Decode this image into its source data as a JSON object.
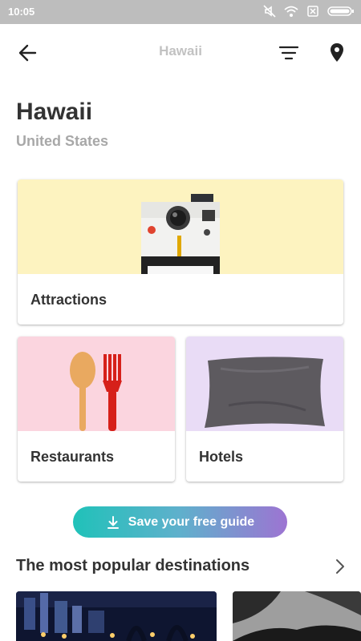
{
  "status": {
    "time": "10:05"
  },
  "appbar": {
    "title": "Hawaii"
  },
  "header": {
    "title": "Hawaii",
    "subtitle": "United States"
  },
  "categories": [
    {
      "label": "Attractions",
      "color": "#fdf3c0"
    },
    {
      "label": "Restaurants",
      "color": "#fbd5df"
    },
    {
      "label": "Hotels",
      "color": "#e9dcf6"
    }
  ],
  "cta": {
    "label": "Save your free guide",
    "gradient": [
      "#20c2b9",
      "#9d74d2"
    ]
  },
  "section": {
    "title": "The most popular destinations"
  }
}
